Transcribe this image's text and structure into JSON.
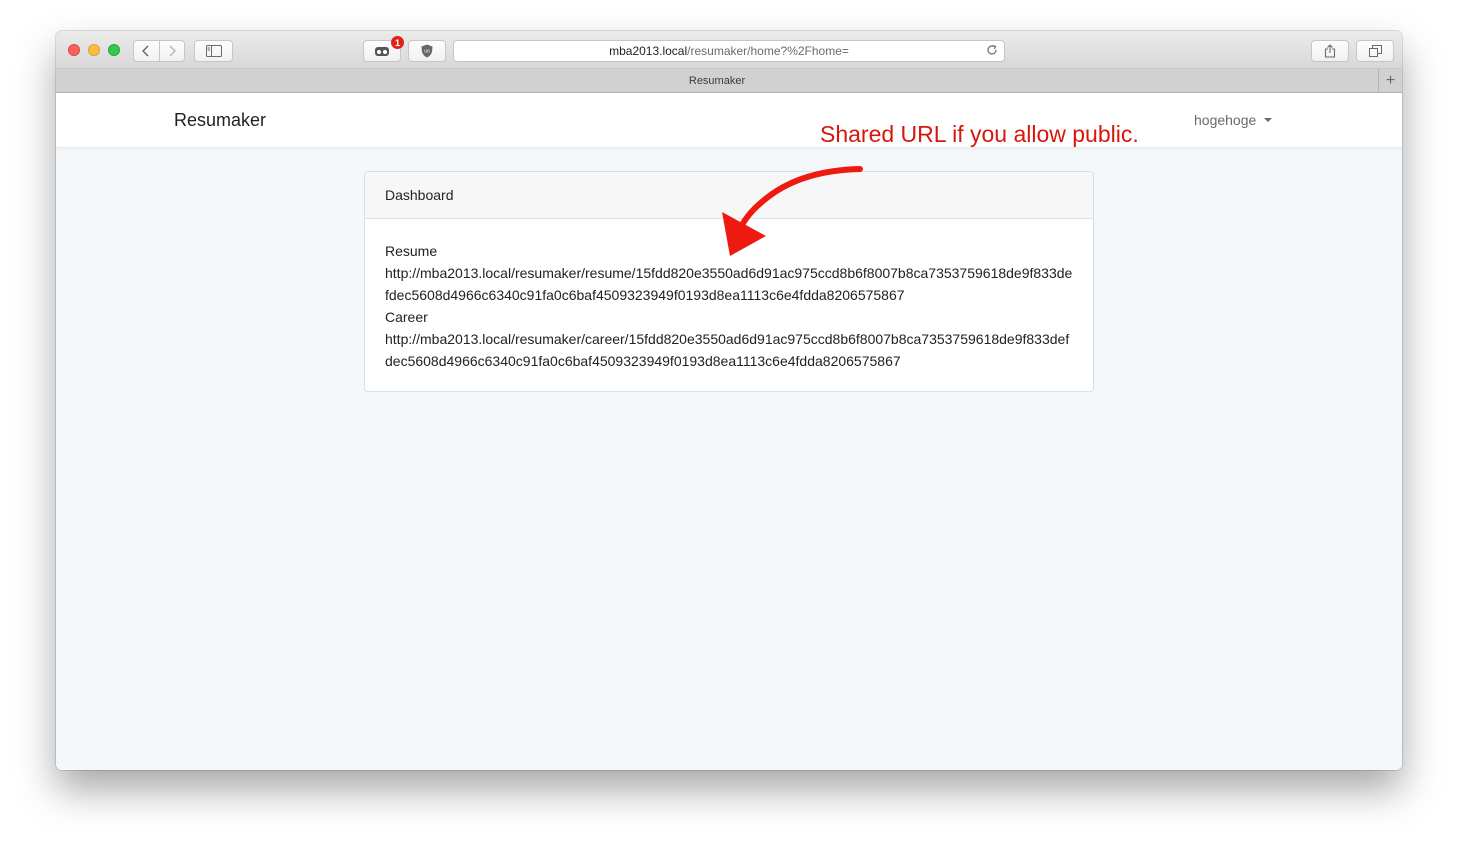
{
  "browser": {
    "url_host": "mba2013.local",
    "url_path": "/resumaker/home?%2Fhome=",
    "tab_title": "Resumaker",
    "extension_badge": "1",
    "new_tab_label": "+"
  },
  "navbar": {
    "brand": "Resumaker",
    "user": "hogehoge"
  },
  "dashboard": {
    "header": "Dashboard",
    "items": [
      {
        "label": "Resume",
        "url": "http://mba2013.local/resumaker/resume/15fdd820e3550ad6d91ac975ccd8b6f8007b8ca7353759618de9f833defdec5608d4966c6340c91fa0c6baf4509323949f0193d8ea1113c6e4fdda8206575867"
      },
      {
        "label": "Career",
        "url": "http://mba2013.local/resumaker/career/15fdd820e3550ad6d91ac975ccd8b6f8007b8ca7353759618de9f833defdec5608d4966c6340c91fa0c6baf4509323949f0193d8ea1113c6e4fdda8206575867"
      }
    ]
  },
  "annotation": {
    "text": "Shared URL if you allow public.",
    "color": "#d8160d"
  }
}
